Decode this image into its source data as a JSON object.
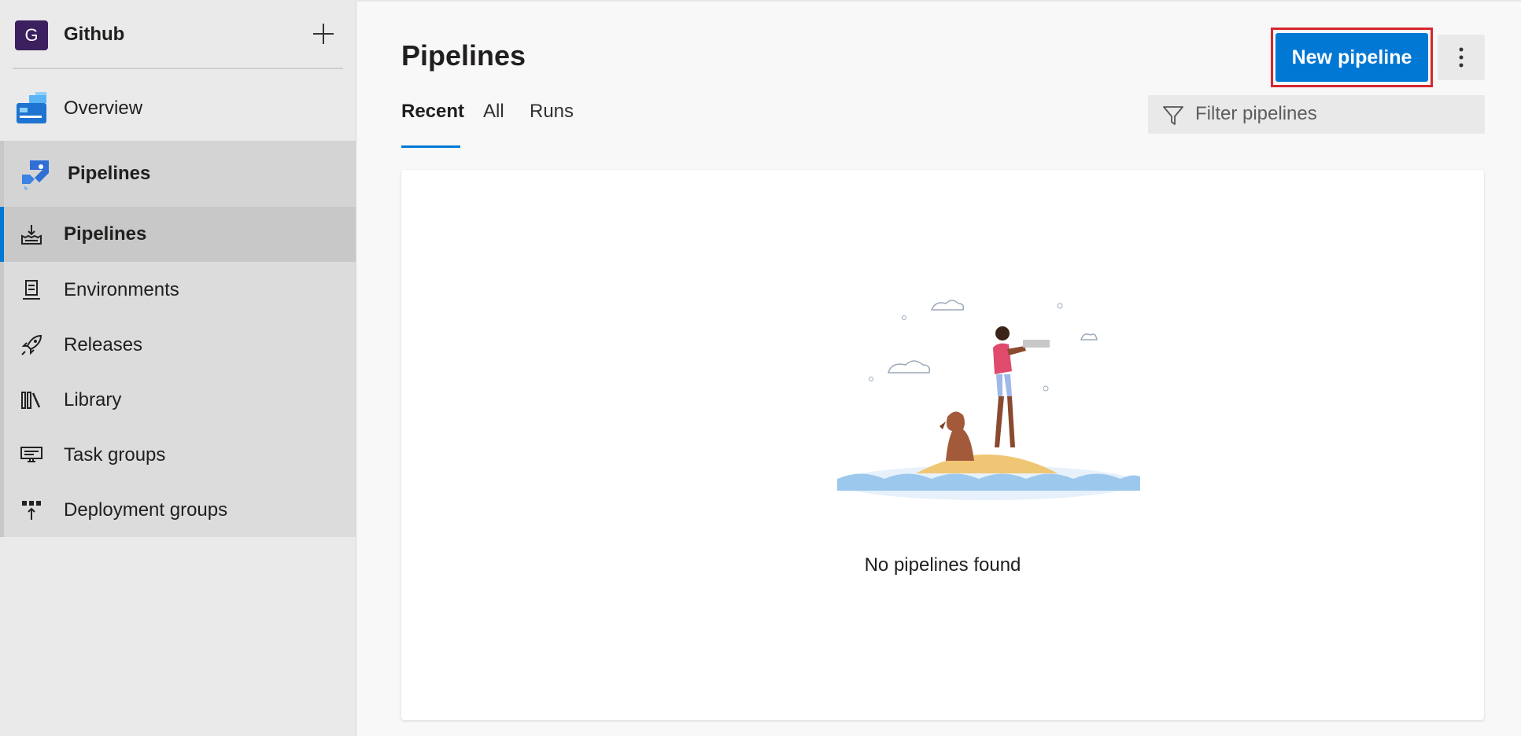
{
  "project": {
    "initial": "G",
    "name": "Github"
  },
  "nav": {
    "overview": {
      "label": "Overview",
      "icon": "overview-icon"
    },
    "pipelines_group": {
      "label": "Pipelines",
      "icon": "pipelines-icon"
    },
    "sub_items": [
      {
        "label": "Pipelines",
        "icon": "pipelines-rocket-icon",
        "selected": true
      },
      {
        "label": "Environments",
        "icon": "environments-icon"
      },
      {
        "label": "Releases",
        "icon": "releases-icon"
      },
      {
        "label": "Library",
        "icon": "library-icon"
      },
      {
        "label": "Task groups",
        "icon": "task-groups-icon"
      },
      {
        "label": "Deployment groups",
        "icon": "deployment-groups-icon"
      }
    ]
  },
  "page": {
    "title": "Pipelines",
    "new_button": "New pipeline",
    "tabs": [
      "Recent",
      "All",
      "Runs"
    ],
    "filter_placeholder": "Filter pipelines",
    "empty_message": "No pipelines found"
  },
  "colors": {
    "accent": "#0078d4",
    "highlight": "#d7262d",
    "avatar": "#3b1f5e"
  }
}
